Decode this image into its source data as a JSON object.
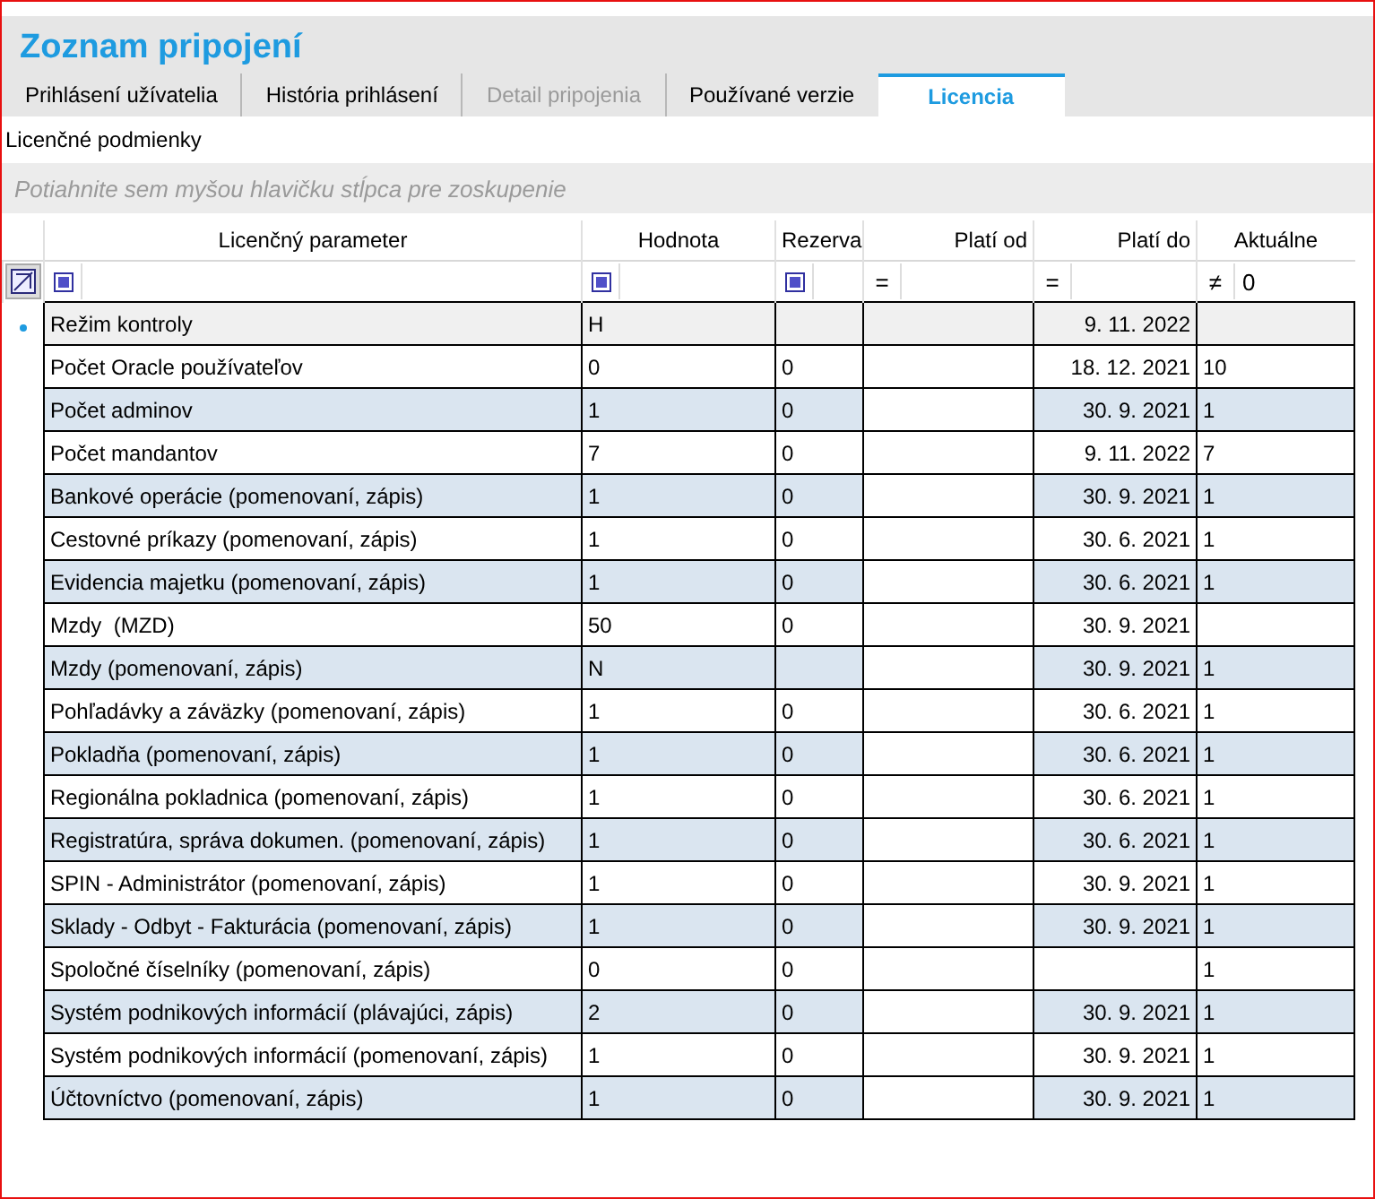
{
  "window": {
    "title": "Zoznam pripojení"
  },
  "tabs": [
    {
      "label": "Prihlásení užívatelia",
      "selected": false,
      "disabled": false
    },
    {
      "label": "História prihlásení",
      "selected": false,
      "disabled": false
    },
    {
      "label": "Detail pripojenia",
      "selected": false,
      "disabled": true
    },
    {
      "label": "Používané verzie",
      "selected": false,
      "disabled": false
    },
    {
      "label": "Licencia",
      "selected": true,
      "disabled": false
    }
  ],
  "section_title": "Licenčné podmienky",
  "group_panel": {
    "placeholder": "Potiahnite sem myšou hlavičku stĺpca pre zoskupenie"
  },
  "table": {
    "columns": [
      {
        "label": "Licenčný parameter"
      },
      {
        "label": "Hodnota"
      },
      {
        "label": "Rezerva"
      },
      {
        "label": "Platí od"
      },
      {
        "label": "Platí do"
      },
      {
        "label": "Aktuálne"
      }
    ],
    "filters": [
      {
        "kind": "box"
      },
      {
        "kind": "box"
      },
      {
        "kind": "box"
      },
      {
        "kind": "operator",
        "operator": "="
      },
      {
        "kind": "operator",
        "operator": "="
      },
      {
        "kind": "operator",
        "operator": "≠",
        "value": "0"
      }
    ],
    "rows": [
      {
        "selected": true,
        "cells": [
          "Režim kontroly",
          "H",
          "",
          "",
          "9. 11. 2022",
          ""
        ]
      },
      {
        "selected": false,
        "cells": [
          "Počet Oracle používateľov",
          "0",
          "0",
          "",
          "18. 12. 2021",
          "10"
        ]
      },
      {
        "selected": false,
        "cells": [
          "Počet adminov",
          "1",
          "0",
          "",
          "30. 9. 2021",
          "1"
        ]
      },
      {
        "selected": false,
        "cells": [
          "Počet mandantov",
          "7",
          "0",
          "",
          "9. 11. 2022",
          "7"
        ]
      },
      {
        "selected": false,
        "cells": [
          "Bankové operácie (pomenovaní, zápis)",
          "1",
          "0",
          "",
          "30. 9. 2021",
          "1"
        ]
      },
      {
        "selected": false,
        "cells": [
          "Cestovné príkazy (pomenovaní, zápis)",
          "1",
          "0",
          "",
          "30. 6. 2021",
          "1"
        ]
      },
      {
        "selected": false,
        "cells": [
          "Evidencia majetku (pomenovaní, zápis)",
          "1",
          "0",
          "",
          "30. 6. 2021",
          "1"
        ]
      },
      {
        "selected": false,
        "cells": [
          "Mzdy  (MZD)",
          "50",
          "0",
          "",
          "30. 9. 2021",
          ""
        ]
      },
      {
        "selected": false,
        "cells": [
          "Mzdy (pomenovaní, zápis)",
          "N",
          "",
          "",
          "30. 9. 2021",
          "1"
        ]
      },
      {
        "selected": false,
        "cells": [
          "Pohľadávky a záväzky (pomenovaní, zápis)",
          "1",
          "0",
          "",
          "30. 6. 2021",
          "1"
        ]
      },
      {
        "selected": false,
        "cells": [
          "Pokladňa (pomenovaní, zápis)",
          "1",
          "0",
          "",
          "30. 6. 2021",
          "1"
        ]
      },
      {
        "selected": false,
        "cells": [
          "Regionálna pokladnica (pomenovaní, zápis)",
          "1",
          "0",
          "",
          "30. 6. 2021",
          "1"
        ]
      },
      {
        "selected": false,
        "cells": [
          "Registratúra, správa dokumen. (pomenovaní, zápis)",
          "1",
          "0",
          "",
          "30. 6. 2021",
          "1"
        ]
      },
      {
        "selected": false,
        "cells": [
          "SPIN - Administrátor (pomenovaní, zápis)",
          "1",
          "0",
          "",
          "30. 9. 2021",
          "1"
        ]
      },
      {
        "selected": false,
        "cells": [
          "Sklady - Odbyt - Fakturácia (pomenovaní, zápis)",
          "1",
          "0",
          "",
          "30. 9. 2021",
          "1"
        ]
      },
      {
        "selected": false,
        "cells": [
          "Spoločné číselníky (pomenovaní, zápis)",
          "0",
          "0",
          "",
          "",
          "1"
        ]
      },
      {
        "selected": false,
        "cells": [
          "Systém podnikových informácií (plávajúci, zápis)",
          "2",
          "0",
          "",
          "30. 9. 2021",
          "1"
        ]
      },
      {
        "selected": false,
        "cells": [
          "Systém podnikových informácií (pomenovaní, zápis)",
          "1",
          "0",
          "",
          "30. 9. 2021",
          "1"
        ]
      },
      {
        "selected": false,
        "cells": [
          "Účtovníctvo (pomenovaní, zápis)",
          "1",
          "0",
          "",
          "30. 9. 2021",
          "1"
        ]
      }
    ]
  }
}
